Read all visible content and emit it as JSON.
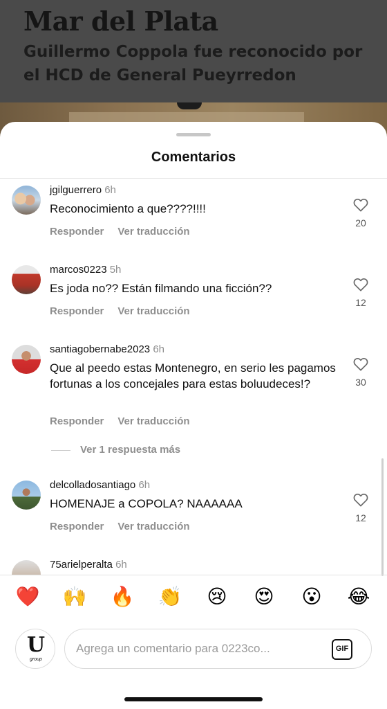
{
  "post": {
    "headline": "Mar del Plata",
    "subheadline": "Guillermo Coppola fue reconocido por el HCD de General Pueyrredon"
  },
  "sheet": {
    "title": "Comentarios"
  },
  "comments": [
    {
      "username": "jgilguerrero",
      "time": "6h",
      "text": "Reconocimiento a que????!!!!",
      "reply_label": "Responder",
      "translate_label": "Ver traducción",
      "likes": "20"
    },
    {
      "username": "marcos0223",
      "time": "5h",
      "text": "Es joda no?? Están filmando una ficción??",
      "reply_label": "Responder",
      "translate_label": "Ver traducción",
      "likes": "12"
    },
    {
      "username": "santiagobernabe2023",
      "time": "6h",
      "text": "Que al peedo estas Montenegro, en serio les pagamos fortunas a los concejales para estas boluudeces!?",
      "reply_label": "Responder",
      "translate_label": "Ver traducción",
      "likes": "30",
      "more_replies": "Ver 1 respuesta más"
    },
    {
      "username": "delcolladosantiago",
      "time": "6h",
      "text": "HOMENAJE a COPOLA? NAAAAAA",
      "reply_label": "Responder",
      "translate_label": "Ver traducción",
      "likes": "12"
    },
    {
      "username": "75arielperalta",
      "time": "6h"
    }
  ],
  "emoji_bar": [
    {
      "icon": "red-heart-icon",
      "glyph": "❤️"
    },
    {
      "icon": "raising-hands-icon",
      "glyph": "🙌"
    },
    {
      "icon": "fire-icon",
      "glyph": "🔥"
    },
    {
      "icon": "clapping-hands-icon",
      "glyph": "👏"
    },
    {
      "icon": "crying-face-icon",
      "glyph": "😢"
    },
    {
      "icon": "heart-eyes-icon",
      "glyph": "😍"
    },
    {
      "icon": "surprised-face-icon",
      "glyph": "😮"
    },
    {
      "icon": "tears-of-joy-icon",
      "glyph": "😂"
    }
  ],
  "composer": {
    "placeholder": "Agrega un comentario para 0223co...",
    "gif_label": "GIF",
    "avatar_letter": "U",
    "avatar_caption": "group"
  }
}
